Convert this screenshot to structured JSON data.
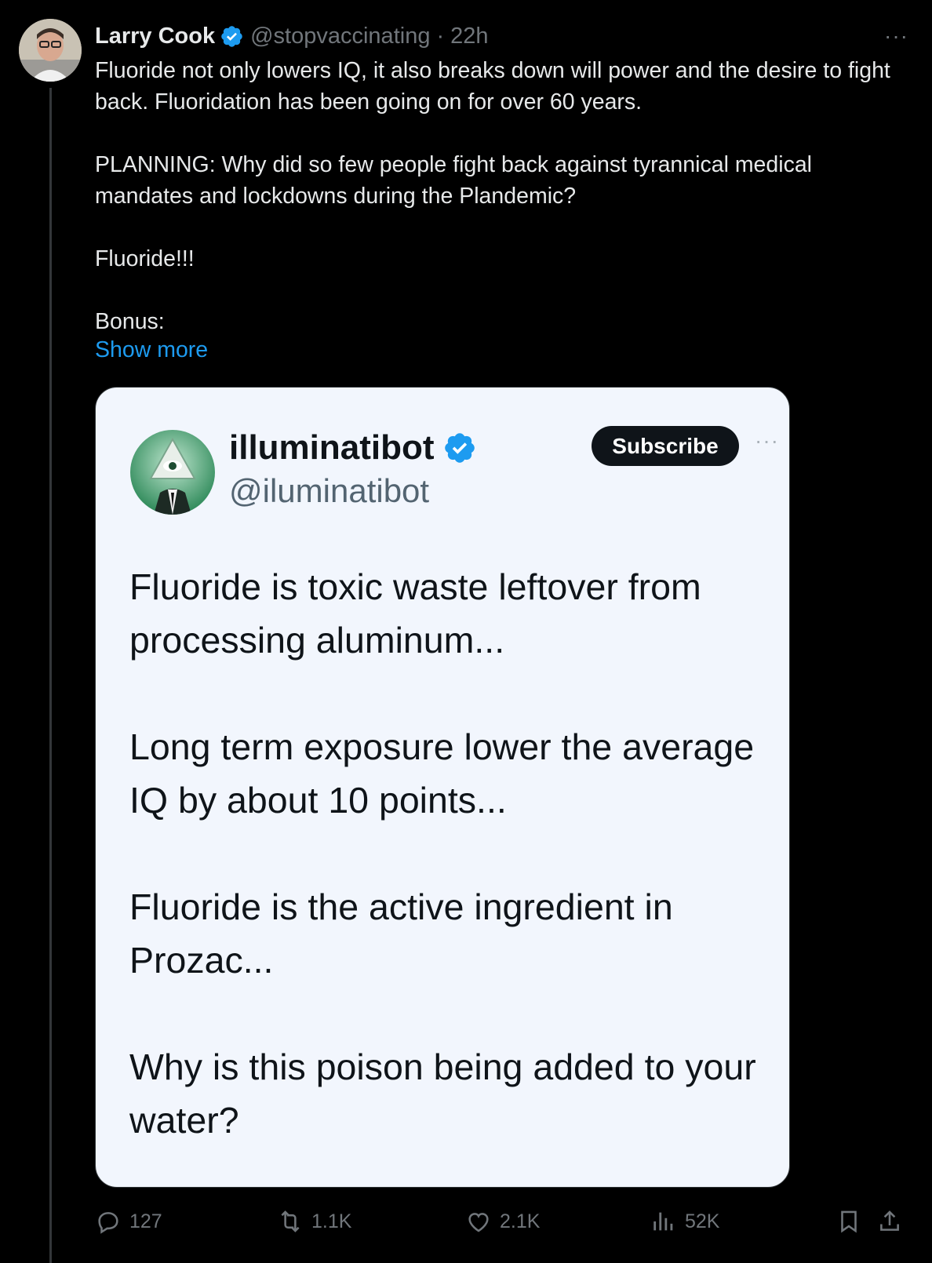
{
  "post": {
    "author_name": "Larry Cook",
    "handle": "@stopvaccinating",
    "separator": "·",
    "time": "22h",
    "more": "···",
    "paragraphs": [
      "Fluoride not only lowers IQ, it also breaks down will power and the desire to fight back. Fluoridation has been going on for over 60 years.",
      "PLANNING: Why did so few people fight back against tyrannical medical mandates and lockdowns during the Plandemic?",
      "Fluoride!!!",
      "Bonus:"
    ],
    "show_more": "Show more"
  },
  "quote": {
    "author_name": "illuminatibot",
    "handle": "@iluminatibot",
    "subscribe": "Subscribe",
    "more": "···",
    "paragraphs": [
      "Fluoride is toxic waste leftover from processing aluminum...",
      "Long term exposure lower the average IQ by about 10 points...",
      "Fluoride is the active ingredient in Prozac...",
      "Why is this poison being added to your water?"
    ]
  },
  "actions": {
    "replies": "127",
    "reposts": "1.1K",
    "likes": "2.1K",
    "views": "52K"
  },
  "colors": {
    "background": "#000000",
    "link": "#1d9bf0",
    "verified": "#1d9bf0",
    "muted": "#71767b",
    "card_bg": "#f2f6fd"
  }
}
